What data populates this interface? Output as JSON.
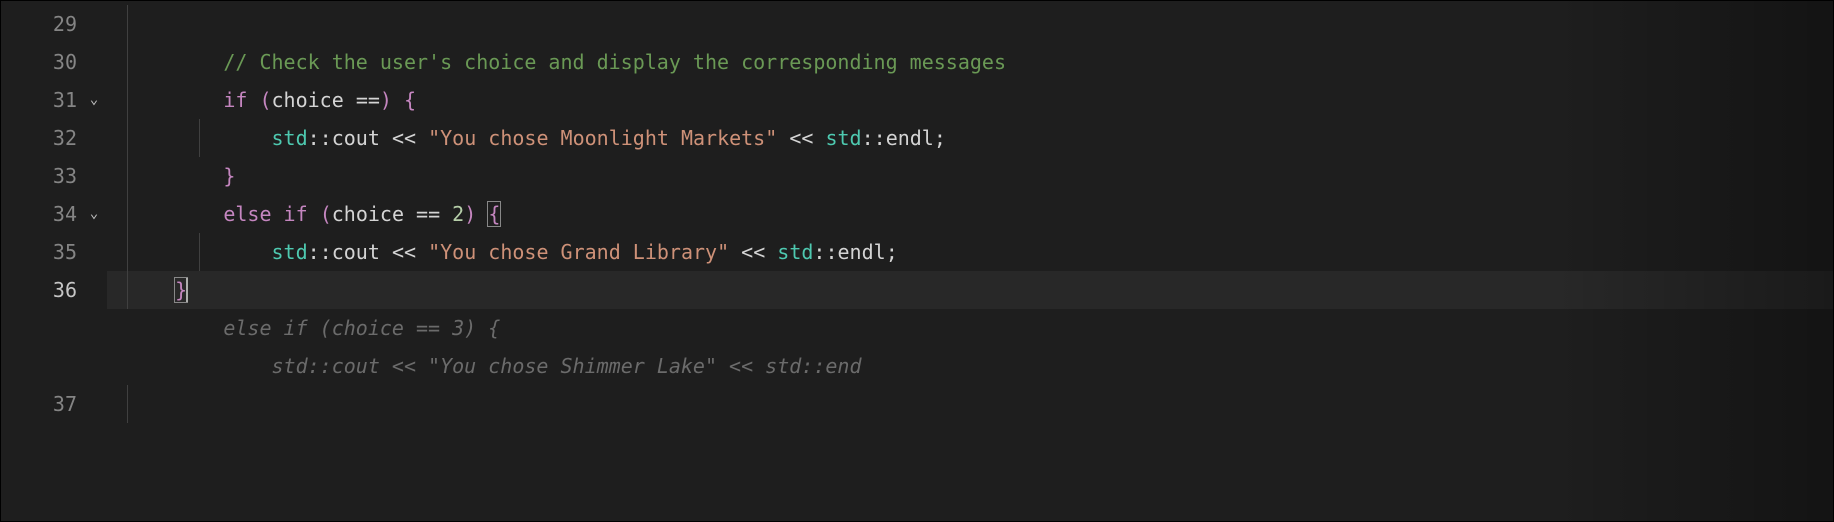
{
  "gutter": {
    "lines": [
      "29",
      "30",
      "31",
      "32",
      "33",
      "34",
      "35",
      "36",
      "",
      "",
      "37"
    ],
    "activeIndex": 7,
    "folds": [
      2,
      5
    ]
  },
  "code": {
    "l29": "",
    "l30": {
      "indent": "        ",
      "comment": "// Check the user's choice and display the corresponding messages"
    },
    "l31": {
      "indent": "        ",
      "if": "if",
      "sp": " ",
      "p1": "(",
      "choice": "choice",
      "sp2": " ",
      "eq": "==",
      "p2": ")",
      "sp3": " ",
      "br": "{"
    },
    "l32": {
      "indent": "            ",
      "std": "std",
      "cc": "::",
      "cout": "cout",
      "sp": " ",
      "lt": "<<",
      "sp2": " ",
      "str": "\"You chose Moonlight Markets\"",
      "sp3": " ",
      "lt2": "<<",
      "sp4": " ",
      "std2": "std",
      "cc2": "::",
      "endl": "endl",
      "semi": ";"
    },
    "l33": {
      "indent": "        ",
      "br": "}"
    },
    "l34": {
      "indent": "        ",
      "else": "else",
      "sp": " ",
      "if": "if",
      "sp2": " ",
      "p1": "(",
      "choice": "choice",
      "sp3": " ",
      "eq": "==",
      "sp4": " ",
      "num": "2",
      "p2": ")",
      "sp5": " ",
      "br": "{"
    },
    "l35": {
      "indent": "            ",
      "std": "std",
      "cc": "::",
      "cout": "cout",
      "sp": " ",
      "lt": "<<",
      "sp2": " ",
      "str": "\"You chose Grand Library\"",
      "sp3": " ",
      "lt2": "<<",
      "sp4": " ",
      "std2": "std",
      "cc2": "::",
      "endl": "endl",
      "semi": ";"
    },
    "l36": {
      "indent": "    ",
      "br": "}"
    },
    "ghost1": {
      "indent": "        ",
      "text": "else if (choice == 3) {"
    },
    "ghost2": {
      "indent": "            ",
      "text": "std::cout << \"You chose Shimmer Lake\" << std::end"
    },
    "l37": ""
  }
}
